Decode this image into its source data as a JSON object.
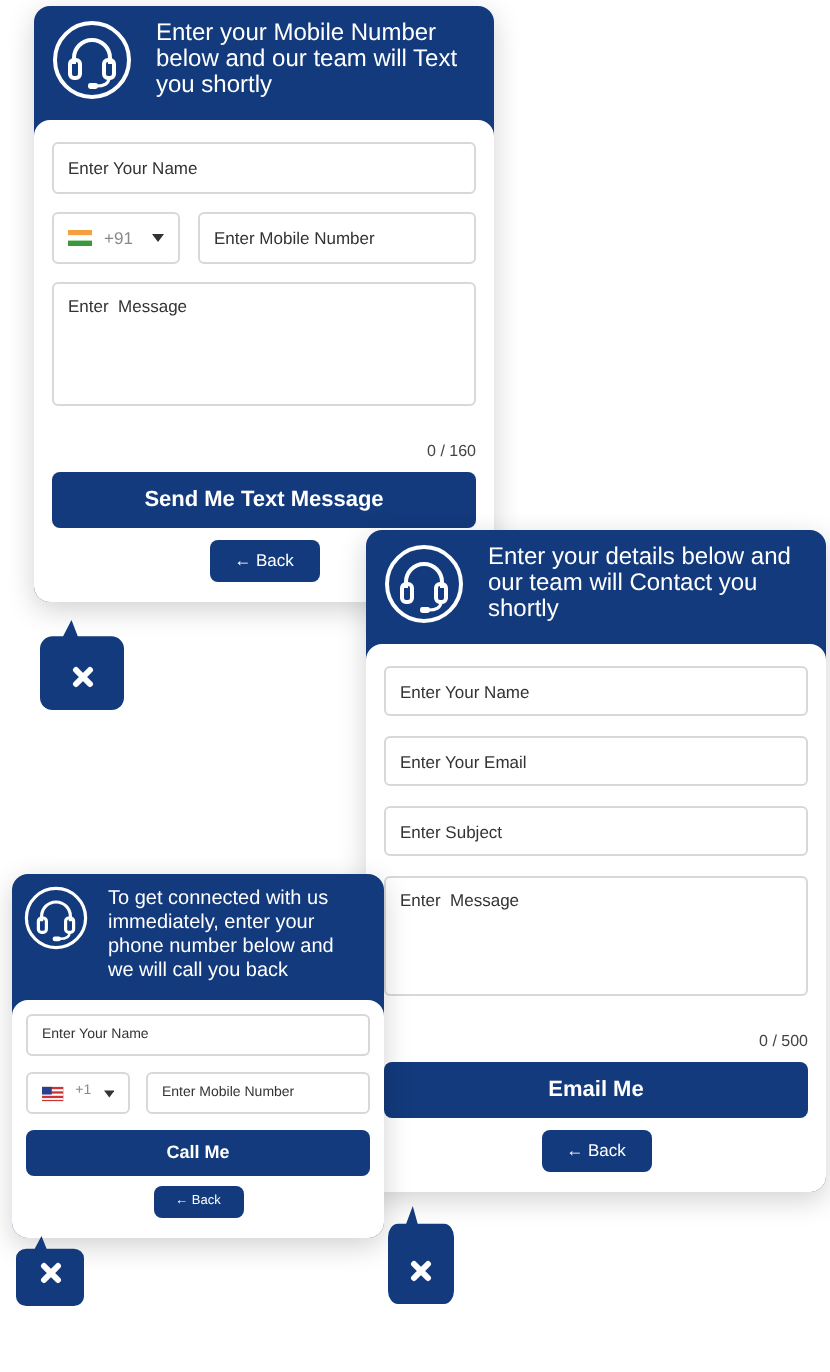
{
  "widgets": [
    {
      "heading": "Enter your Mobile Number below and our team will Text you shortly",
      "fields": [
        {
          "kind": "text",
          "placeholder": "Enter Your Name"
        },
        {
          "kind": "phone",
          "flag": {
            "kind": "india"
          },
          "code": "+91",
          "placeholder": "Enter Mobile Number"
        },
        {
          "kind": "textarea",
          "placeholder": "Enter  Message"
        }
      ],
      "counter": "0 / 160",
      "submit": "Send Me Text Message",
      "back": "← Back"
    },
    {
      "heading": "Enter your details below and our team will Contact you shortly",
      "fields": [
        {
          "kind": "text",
          "placeholder": "Enter Your Name"
        },
        {
          "kind": "text",
          "placeholder": "Enter Your Email"
        },
        {
          "kind": "text",
          "placeholder": "Enter Subject"
        },
        {
          "kind": "textarea",
          "placeholder": "Enter  Message"
        }
      ],
      "counter": "0 / 500",
      "submit": "Email Me",
      "back": "← Back"
    },
    {
      "heading": "To get connected with us immediately, enter your phone number below and we will call you back",
      "fields": [
        {
          "kind": "text",
          "placeholder": "Enter Your Name"
        },
        {
          "kind": "phone",
          "flag": {
            "kind": "usa"
          },
          "code": "+1",
          "placeholder": "Enter Mobile Number"
        }
      ],
      "submit": "Call Me",
      "back": "← Back"
    }
  ]
}
